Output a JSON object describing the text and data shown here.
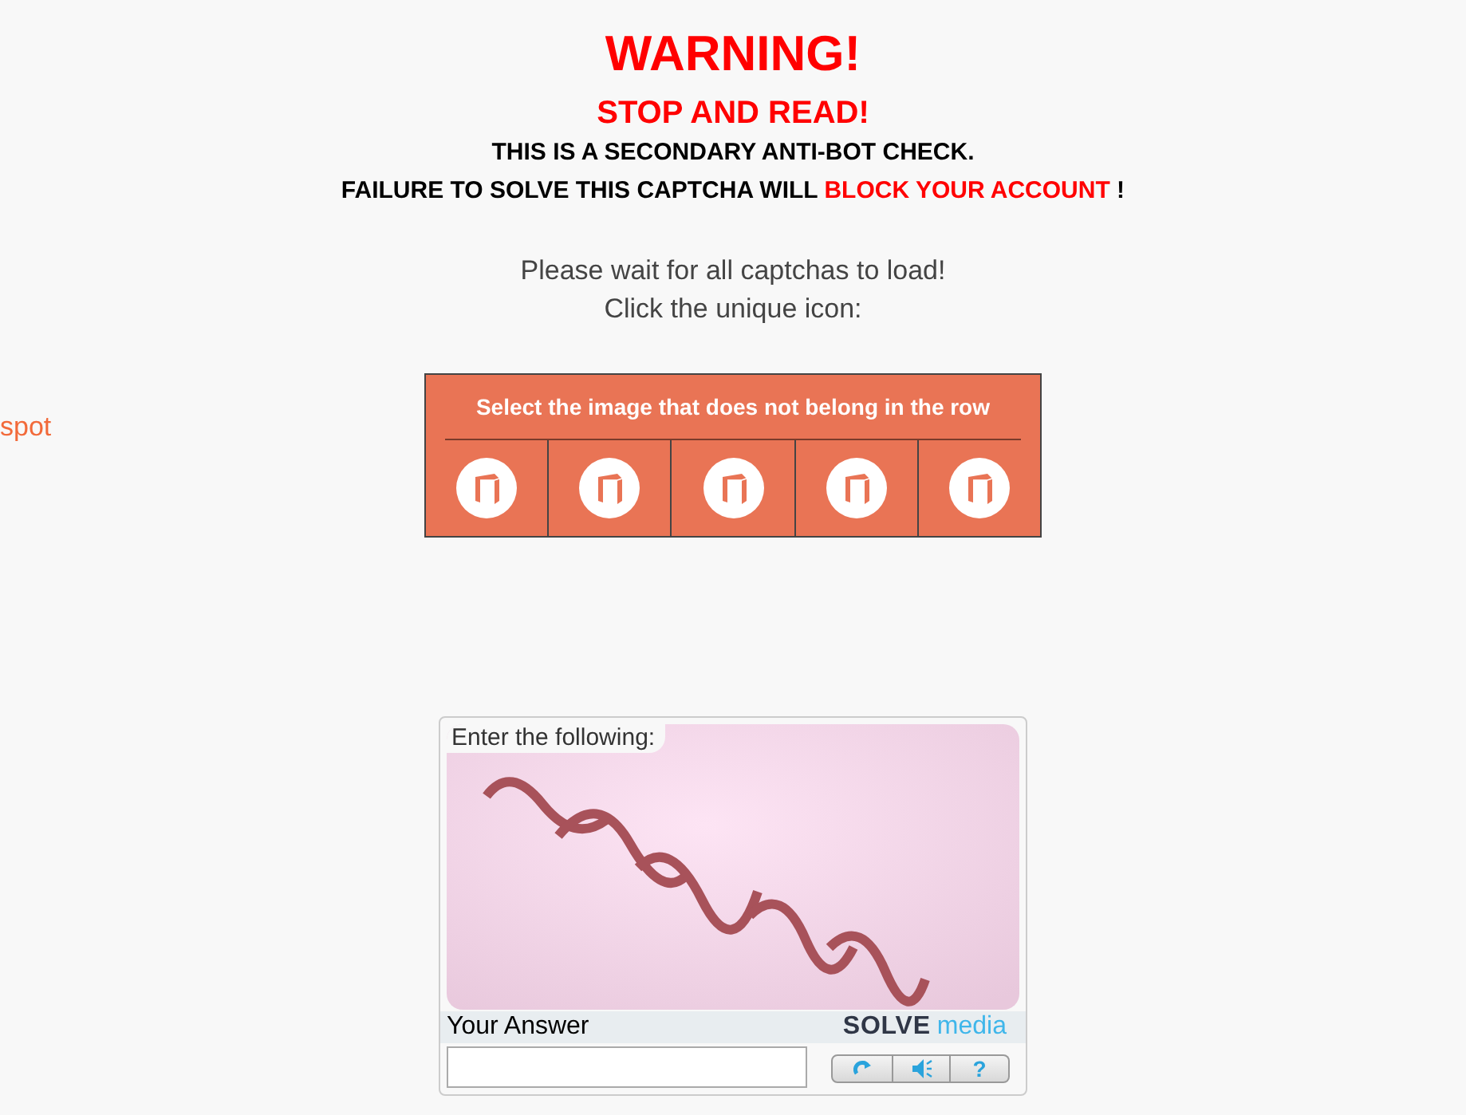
{
  "heading": "WARNING!",
  "subheading": "STOP AND READ!",
  "notice_line": "THIS IS A SECONDARY ANTI-BOT CHECK.",
  "failure_line": {
    "before": "FAILURE TO SOLVE THIS CAPTCHA WILL ",
    "highlight": "BLOCK YOUR ACCOUNT",
    "after": " !"
  },
  "instructions": [
    "Please wait for all captchas to load!",
    "Click the unique icon:"
  ],
  "side_link": "spot",
  "icon_captcha": {
    "prompt": "Select the image that does not belong in the row",
    "tiles": [
      {
        "kind": "box"
      },
      {
        "kind": "box"
      },
      {
        "kind": "box"
      },
      {
        "kind": "box"
      },
      {
        "kind": "box"
      }
    ]
  },
  "text_captcha": {
    "label": "Enter the following:",
    "answer_label": "Your Answer",
    "brand": {
      "word_1": "SOLVE",
      "word_2": "media"
    },
    "buttons": [
      {
        "kind": "refresh"
      },
      {
        "kind": "audio"
      },
      {
        "kind": "help",
        "label": "?"
      }
    ]
  }
}
